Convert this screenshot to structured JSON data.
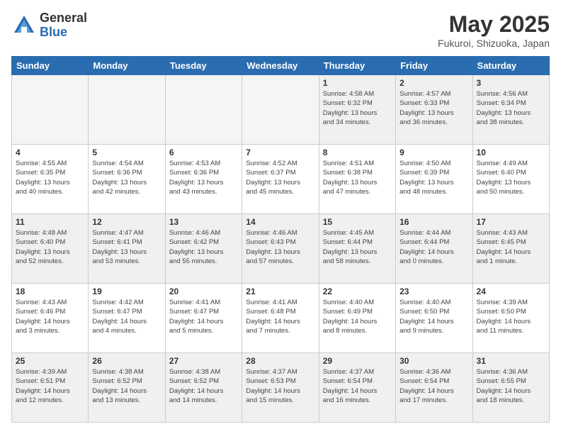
{
  "header": {
    "logo_general": "General",
    "logo_blue": "Blue",
    "title": "May 2025",
    "subtitle": "Fukuroi, Shizuoka, Japan"
  },
  "days_of_week": [
    "Sunday",
    "Monday",
    "Tuesday",
    "Wednesday",
    "Thursday",
    "Friday",
    "Saturday"
  ],
  "weeks": [
    [
      {
        "day": "",
        "info": ""
      },
      {
        "day": "",
        "info": ""
      },
      {
        "day": "",
        "info": ""
      },
      {
        "day": "",
        "info": ""
      },
      {
        "day": "1",
        "info": "Sunrise: 4:58 AM\nSunset: 6:32 PM\nDaylight: 13 hours\nand 34 minutes."
      },
      {
        "day": "2",
        "info": "Sunrise: 4:57 AM\nSunset: 6:33 PM\nDaylight: 13 hours\nand 36 minutes."
      },
      {
        "day": "3",
        "info": "Sunrise: 4:56 AM\nSunset: 6:34 PM\nDaylight: 13 hours\nand 38 minutes."
      }
    ],
    [
      {
        "day": "4",
        "info": "Sunrise: 4:55 AM\nSunset: 6:35 PM\nDaylight: 13 hours\nand 40 minutes."
      },
      {
        "day": "5",
        "info": "Sunrise: 4:54 AM\nSunset: 6:36 PM\nDaylight: 13 hours\nand 42 minutes."
      },
      {
        "day": "6",
        "info": "Sunrise: 4:53 AM\nSunset: 6:36 PM\nDaylight: 13 hours\nand 43 minutes."
      },
      {
        "day": "7",
        "info": "Sunrise: 4:52 AM\nSunset: 6:37 PM\nDaylight: 13 hours\nand 45 minutes."
      },
      {
        "day": "8",
        "info": "Sunrise: 4:51 AM\nSunset: 6:38 PM\nDaylight: 13 hours\nand 47 minutes."
      },
      {
        "day": "9",
        "info": "Sunrise: 4:50 AM\nSunset: 6:39 PM\nDaylight: 13 hours\nand 48 minutes."
      },
      {
        "day": "10",
        "info": "Sunrise: 4:49 AM\nSunset: 6:40 PM\nDaylight: 13 hours\nand 50 minutes."
      }
    ],
    [
      {
        "day": "11",
        "info": "Sunrise: 4:48 AM\nSunset: 6:40 PM\nDaylight: 13 hours\nand 52 minutes."
      },
      {
        "day": "12",
        "info": "Sunrise: 4:47 AM\nSunset: 6:41 PM\nDaylight: 13 hours\nand 53 minutes."
      },
      {
        "day": "13",
        "info": "Sunrise: 4:46 AM\nSunset: 6:42 PM\nDaylight: 13 hours\nand 55 minutes."
      },
      {
        "day": "14",
        "info": "Sunrise: 4:46 AM\nSunset: 6:43 PM\nDaylight: 13 hours\nand 57 minutes."
      },
      {
        "day": "15",
        "info": "Sunrise: 4:45 AM\nSunset: 6:44 PM\nDaylight: 13 hours\nand 58 minutes."
      },
      {
        "day": "16",
        "info": "Sunrise: 4:44 AM\nSunset: 6:44 PM\nDaylight: 14 hours\nand 0 minutes."
      },
      {
        "day": "17",
        "info": "Sunrise: 4:43 AM\nSunset: 6:45 PM\nDaylight: 14 hours\nand 1 minute."
      }
    ],
    [
      {
        "day": "18",
        "info": "Sunrise: 4:43 AM\nSunset: 6:46 PM\nDaylight: 14 hours\nand 3 minutes."
      },
      {
        "day": "19",
        "info": "Sunrise: 4:42 AM\nSunset: 6:47 PM\nDaylight: 14 hours\nand 4 minutes."
      },
      {
        "day": "20",
        "info": "Sunrise: 4:41 AM\nSunset: 6:47 PM\nDaylight: 14 hours\nand 5 minutes."
      },
      {
        "day": "21",
        "info": "Sunrise: 4:41 AM\nSunset: 6:48 PM\nDaylight: 14 hours\nand 7 minutes."
      },
      {
        "day": "22",
        "info": "Sunrise: 4:40 AM\nSunset: 6:49 PM\nDaylight: 14 hours\nand 8 minutes."
      },
      {
        "day": "23",
        "info": "Sunrise: 4:40 AM\nSunset: 6:50 PM\nDaylight: 14 hours\nand 9 minutes."
      },
      {
        "day": "24",
        "info": "Sunrise: 4:39 AM\nSunset: 6:50 PM\nDaylight: 14 hours\nand 11 minutes."
      }
    ],
    [
      {
        "day": "25",
        "info": "Sunrise: 4:39 AM\nSunset: 6:51 PM\nDaylight: 14 hours\nand 12 minutes."
      },
      {
        "day": "26",
        "info": "Sunrise: 4:38 AM\nSunset: 6:52 PM\nDaylight: 14 hours\nand 13 minutes."
      },
      {
        "day": "27",
        "info": "Sunrise: 4:38 AM\nSunset: 6:52 PM\nDaylight: 14 hours\nand 14 minutes."
      },
      {
        "day": "28",
        "info": "Sunrise: 4:37 AM\nSunset: 6:53 PM\nDaylight: 14 hours\nand 15 minutes."
      },
      {
        "day": "29",
        "info": "Sunrise: 4:37 AM\nSunset: 6:54 PM\nDaylight: 14 hours\nand 16 minutes."
      },
      {
        "day": "30",
        "info": "Sunrise: 4:36 AM\nSunset: 6:54 PM\nDaylight: 14 hours\nand 17 minutes."
      },
      {
        "day": "31",
        "info": "Sunrise: 4:36 AM\nSunset: 6:55 PM\nDaylight: 14 hours\nand 18 minutes."
      }
    ]
  ]
}
